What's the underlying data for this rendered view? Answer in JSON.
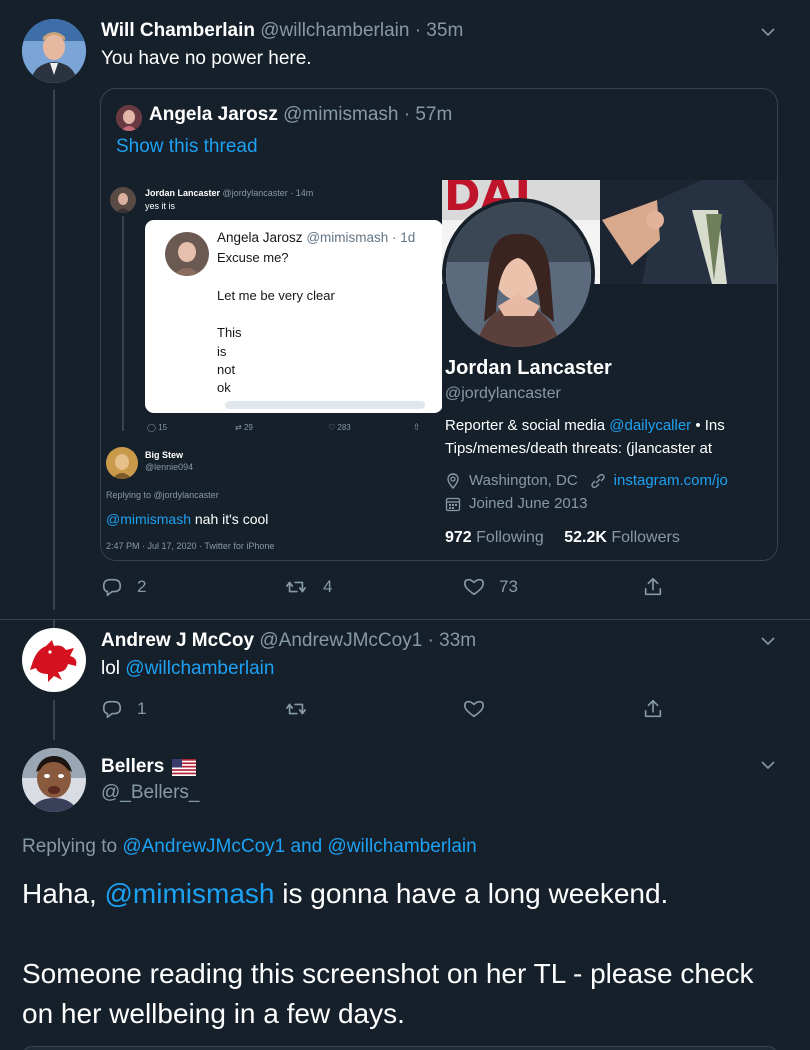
{
  "tweet1": {
    "name": "Will Chamberlain",
    "handle": "@willchamberlain",
    "time": "· 35m",
    "text": "You have no power here.",
    "quote": {
      "name": "Angela Jarosz",
      "handle": "@mimismash",
      "time": "· 57m",
      "show_thread": "Show this thread",
      "left_shot": {
        "top_name": "Jordan Lancaster",
        "top_handle": "@jordylancaster · 14m",
        "top_text": "yes it is",
        "inner_name": "Angela Jarosz",
        "inner_handle": "@mimismash · 1d",
        "inner_lines": [
          "Excuse me?",
          "Let me be very clear",
          "This",
          "is",
          "not",
          "ok"
        ],
        "stats": [
          "15",
          "29",
          "283"
        ],
        "reply_name": "Big Stew",
        "reply_handle": "@lennie094",
        "replying_to": "Replying to @jordylancaster",
        "reply_mention": "@mimismash",
        "reply_text": " nah it's cool",
        "footer": "2:47 PM · Jul 17, 2020 · Twitter for iPhone"
      },
      "right_shot": {
        "banner_text": "TH DAI",
        "name": "Jordan Lancaster",
        "handle": "@jordylancaster",
        "bio1_pre": "Reporter & social media ",
        "bio1_link": "@dailycaller",
        "bio1_post": " • Ins",
        "bio2": "Tips/memes/death threats: (jlancaster at",
        "location": "Washington, DC",
        "link": "instagram.com/jo",
        "joined": "Joined June 2013",
        "following_count": "972",
        "following_label": "Following",
        "followers_count": "52.2K",
        "followers_label": "Followers"
      }
    },
    "actions": {
      "replies": "2",
      "retweets": "4",
      "likes": "73"
    }
  },
  "tweet2": {
    "name": "Andrew J McCoy",
    "handle": "@AndrewJMcCoy1",
    "time": "· 33m",
    "text_pre": "lol ",
    "mention": "@willchamberlain",
    "actions": {
      "replies": "1"
    }
  },
  "tweet3": {
    "name": "Bellers",
    "handle": "@_Bellers_",
    "replying_label": "Replying to ",
    "replying_a": "@AndrewJMcCoy1",
    "replying_and": " and ",
    "replying_b": "@willchamberlain",
    "text_pre": "Haha, ",
    "text_mention": "@mimismash",
    "text_post": " is gonna have a long weekend.",
    "text2": "Someone reading this screenshot on her TL - please check on her wellbeing in a few days."
  },
  "colors": {
    "background": "#15202b",
    "accent": "#1da1f2",
    "muted": "#8899a6",
    "border": "#38444d"
  }
}
